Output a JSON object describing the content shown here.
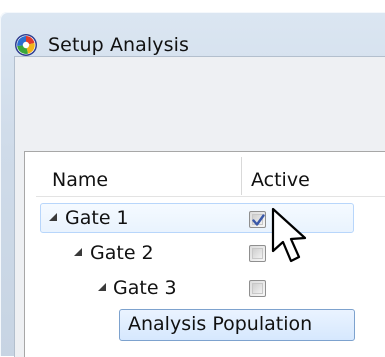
{
  "window": {
    "title": "Setup Analysis"
  },
  "grid": {
    "headers": {
      "name": "Name",
      "active": "Active"
    },
    "rows": [
      {
        "label": "Gate 1",
        "active": true,
        "selected": true
      },
      {
        "label": "Gate 2",
        "active": false
      },
      {
        "label": "Gate 3",
        "active": false
      },
      {
        "label": "Analysis Population",
        "editing": true
      }
    ]
  },
  "icons": {
    "app": "app-logo-icon",
    "expand": "expand-triangle-icon",
    "cursor": "mouse-pointer-icon"
  },
  "colors": {
    "selection_border": "#b8d6fb",
    "edit_border": "#7da2ce",
    "check": "#3a58a8"
  }
}
